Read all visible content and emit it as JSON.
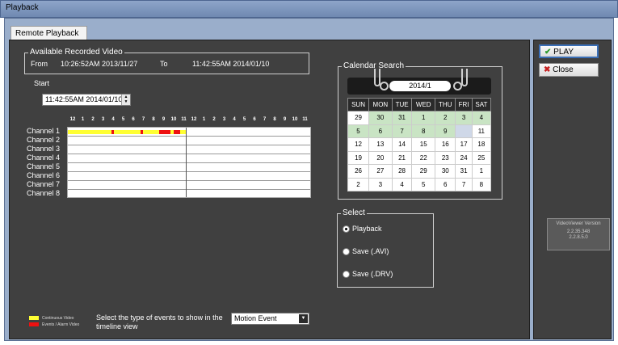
{
  "window": {
    "title": "Playback"
  },
  "tab": {
    "label": "Remote Playback"
  },
  "recorded": {
    "title": "Available Recorded Video",
    "from_label": "From",
    "from_value": "10:26:52AM 2013/11/27",
    "to_label": "To",
    "to_value": "11:42:55AM 2014/01/10"
  },
  "start": {
    "label": "Start",
    "value": "11:42:55AM 2014/01/10"
  },
  "timeline": {
    "hours": [
      "12",
      "1",
      "2",
      "3",
      "4",
      "5",
      "6",
      "7",
      "8",
      "9",
      "10",
      "11",
      "12",
      "1",
      "2",
      "3",
      "4",
      "5",
      "6",
      "7",
      "8",
      "9",
      "10",
      "11"
    ],
    "channels": [
      "Channel 1",
      "Channel 2",
      "Channel 3",
      "Channel 4",
      "Channel 5",
      "Channel 6",
      "Channel 7",
      "Channel 8"
    ]
  },
  "calendar": {
    "title": "Calendar Search",
    "month": "2014/1",
    "weekdays": [
      "SUN",
      "MON",
      "TUE",
      "WED",
      "THU",
      "FRI",
      "SAT"
    ],
    "weeks": [
      [
        "29",
        "30",
        "31",
        "1",
        "2",
        "3",
        "4"
      ],
      [
        "5",
        "6",
        "7",
        "8",
        "9",
        "",
        "11"
      ],
      [
        "12",
        "13",
        "14",
        "15",
        "16",
        "17",
        "18"
      ],
      [
        "19",
        "20",
        "21",
        "22",
        "23",
        "24",
        "25"
      ],
      [
        "26",
        "27",
        "28",
        "29",
        "30",
        "31",
        "1"
      ],
      [
        "2",
        "3",
        "4",
        "5",
        "6",
        "7",
        "8"
      ]
    ]
  },
  "select": {
    "title": "Select",
    "options": [
      "Playback",
      "Save (.AVI)",
      "Save (.DRV)"
    ],
    "selected": "Playback"
  },
  "legend": {
    "continuous": "Continuous Video",
    "event": "Events / Alarm Video",
    "continuous_color": "#ffff33",
    "event_color": "#ee1111"
  },
  "event_type": {
    "prompt": "Select the type of events to show in the timeline view",
    "value": "Motion Event"
  },
  "buttons": {
    "play": "PLAY",
    "close": "Close"
  },
  "version": {
    "title": "VideoViewer Version",
    "value": "2.2.35.348\n2.2.8.5.0"
  },
  "colors": {
    "panel": "#404040",
    "accent": "#3b6fb6"
  }
}
